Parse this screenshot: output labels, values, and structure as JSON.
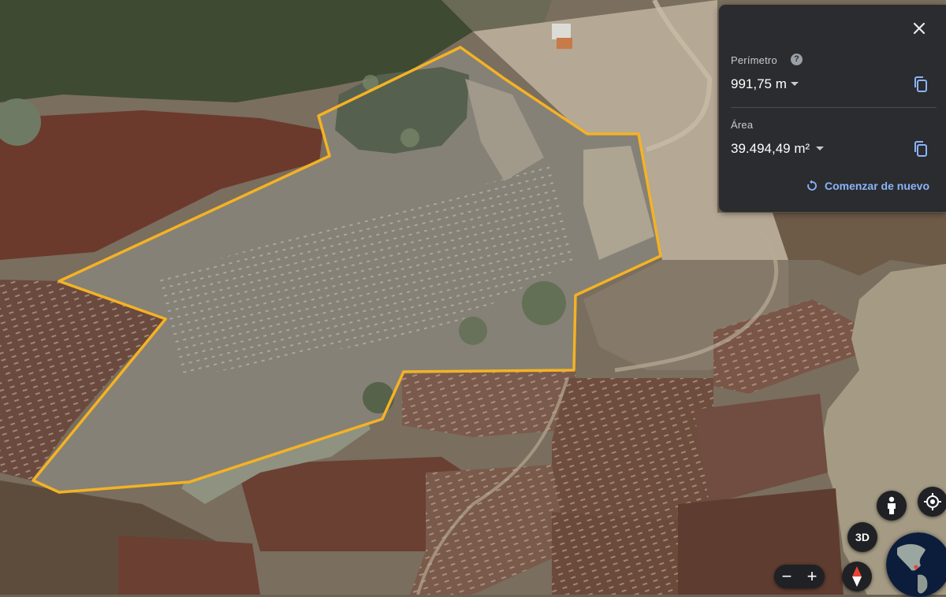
{
  "measure_panel": {
    "perimeter_label": "Perímetro",
    "perimeter_value": "991,75 m",
    "area_label": "Área",
    "area_value": "39.494,49 m²",
    "restart_label": "Comenzar de nuevo",
    "help_glyph": "?"
  },
  "map_controls": {
    "button_3d": "3D",
    "zoom_out": "−",
    "zoom_in": "+"
  },
  "colors": {
    "polygon_outline": "#f4b224",
    "link_blue": "#8ab4f8",
    "panel_bg": "#2b2c2f"
  },
  "icons": [
    "close-icon",
    "help-icon",
    "copy-icon",
    "restart-icon",
    "pegman-icon",
    "my-location-icon",
    "compass-icon",
    "globe-icon"
  ]
}
